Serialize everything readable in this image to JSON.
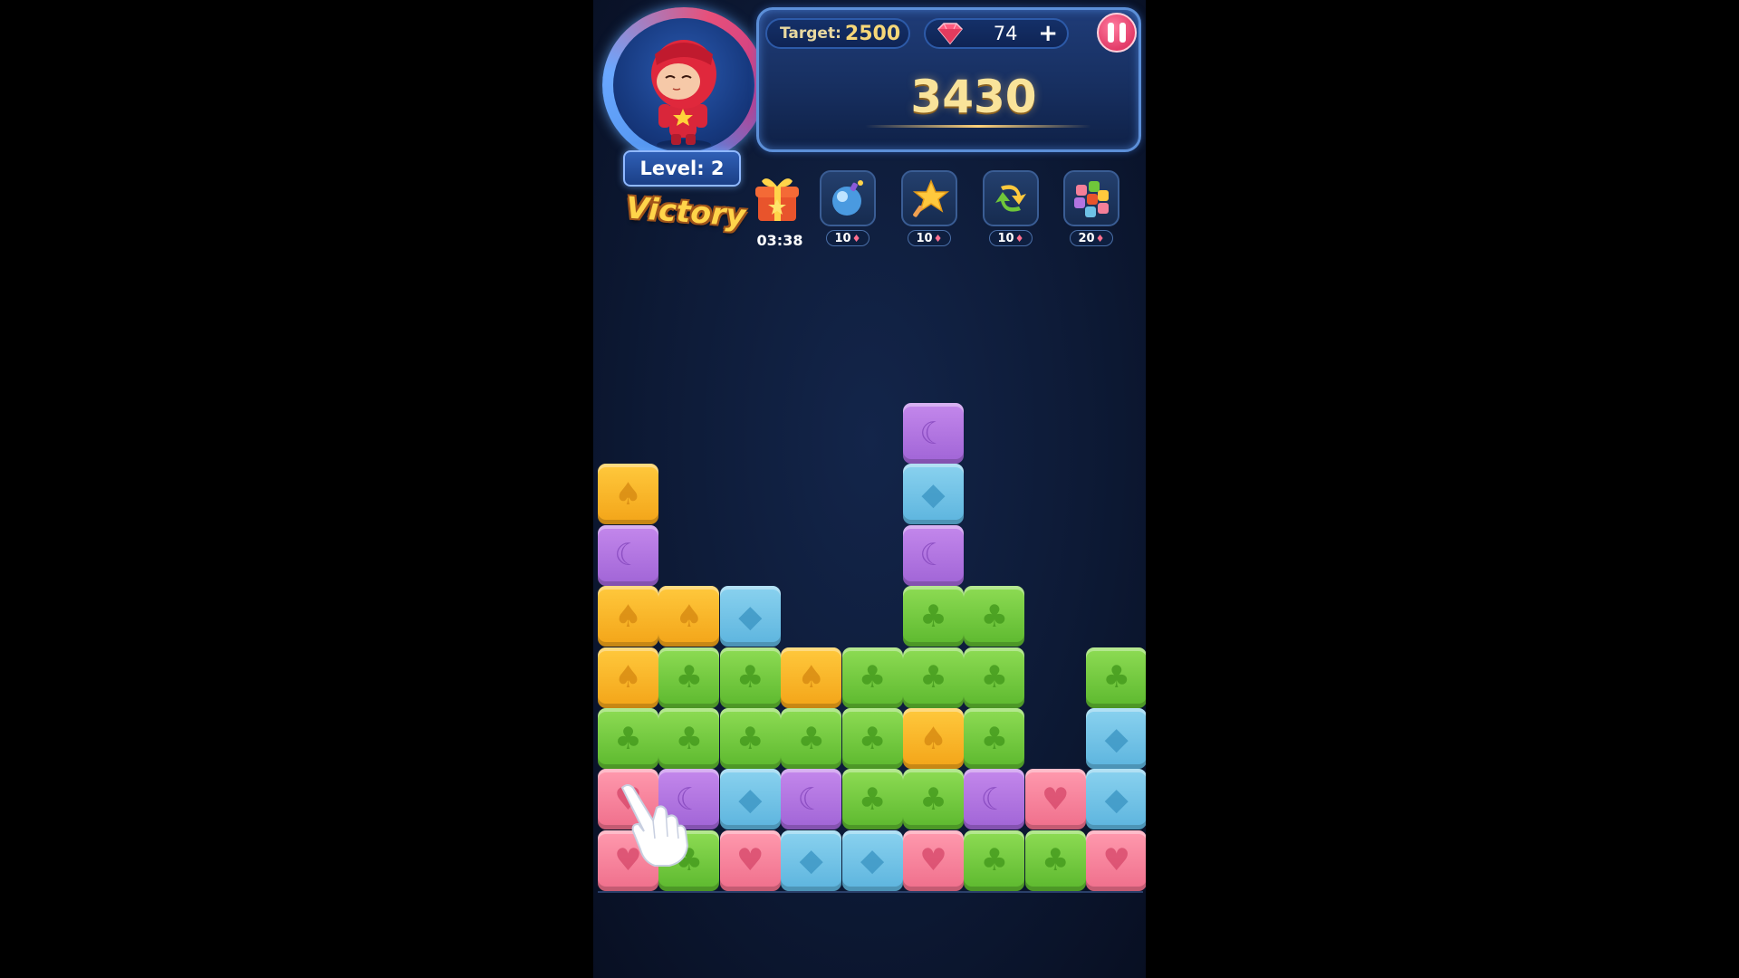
{
  "hud": {
    "target_label": "Target:",
    "target_value": "2500",
    "gems": "74",
    "plus_label": "+",
    "score": "3430",
    "level_text": "Level: 2",
    "victory_text": "Victory"
  },
  "boosters": [
    {
      "name": "gift-box",
      "timer": "03:38"
    },
    {
      "name": "bomb",
      "cost": "10"
    },
    {
      "name": "hammer",
      "cost": "10"
    },
    {
      "name": "color-swap",
      "cost": "10"
    },
    {
      "name": "shuffle",
      "cost": "20"
    }
  ],
  "colors": {
    "yellow": "#f7b026",
    "purple": "#b274e0",
    "blue": "#6ec1e6",
    "green": "#6fc63a",
    "red": "#f57f98",
    "accent_gold": "#f9e39a",
    "pause_red": "#e23b68"
  },
  "symbols": {
    "Y": "♠",
    "P": "☾",
    "B": "◆",
    "G": "♣",
    "R": "♥"
  },
  "board": {
    "rows_top_to_bottom": [
      "     P   ",
      "Y    B   ",
      "P    P   ",
      "YYB  GG  ",
      "YGGYGGG G",
      "GGGGGYG B",
      "RPBPGGPRB",
      "RGRBBRGGR"
    ],
    "legend": {
      "Y": "yellow-spade",
      "P": "purple-moon",
      "B": "blue-diamond",
      "G": "green-club",
      "R": "red-heart"
    }
  }
}
